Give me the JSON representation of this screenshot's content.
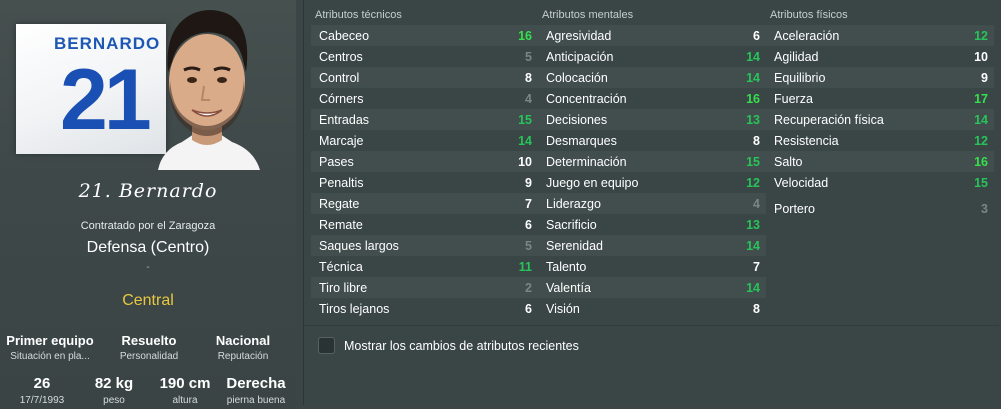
{
  "profile": {
    "kit_name": "BERNARDO",
    "kit_number": "21",
    "signature": "21. Bernardo",
    "contract": "Contratado por el Zaragoza",
    "position": "Defensa (Centro)",
    "dash": "-",
    "role": "Central",
    "info_top": [
      {
        "main": "Primer equipo",
        "sub": "Situación en pla..."
      },
      {
        "main": "Resuelto",
        "sub": "Personalidad"
      },
      {
        "main": "Nacional",
        "sub": "Reputación"
      }
    ],
    "info_bottom": [
      {
        "main": "26",
        "sub": "17/7/1993"
      },
      {
        "main": "82 kg",
        "sub": "peso"
      },
      {
        "main": "190 cm",
        "sub": "altura"
      },
      {
        "main": "Derecha",
        "sub": "pierna buena"
      }
    ]
  },
  "attributes": {
    "technical": {
      "title": "Atributos técnicos",
      "items": [
        {
          "label": "Cabeceo",
          "value": "16"
        },
        {
          "label": "Centros",
          "value": "5"
        },
        {
          "label": "Control",
          "value": "8"
        },
        {
          "label": "Córners",
          "value": "4"
        },
        {
          "label": "Entradas",
          "value": "15"
        },
        {
          "label": "Marcaje",
          "value": "14"
        },
        {
          "label": "Pases",
          "value": "10"
        },
        {
          "label": "Penaltis",
          "value": "9"
        },
        {
          "label": "Regate",
          "value": "7"
        },
        {
          "label": "Remate",
          "value": "6"
        },
        {
          "label": "Saques largos",
          "value": "5"
        },
        {
          "label": "Técnica",
          "value": "11"
        },
        {
          "label": "Tiro libre",
          "value": "2"
        },
        {
          "label": "Tiros lejanos",
          "value": "6"
        }
      ]
    },
    "mental": {
      "title": "Atributos mentales",
      "items": [
        {
          "label": "Agresividad",
          "value": "6"
        },
        {
          "label": "Anticipación",
          "value": "14"
        },
        {
          "label": "Colocación",
          "value": "14"
        },
        {
          "label": "Concentración",
          "value": "16"
        },
        {
          "label": "Decisiones",
          "value": "13"
        },
        {
          "label": "Desmarques",
          "value": "8"
        },
        {
          "label": "Determinación",
          "value": "15"
        },
        {
          "label": "Juego en equipo",
          "value": "12"
        },
        {
          "label": "Liderazgo",
          "value": "4"
        },
        {
          "label": "Sacrificio",
          "value": "13"
        },
        {
          "label": "Serenidad",
          "value": "14"
        },
        {
          "label": "Talento",
          "value": "7"
        },
        {
          "label": "Valentía",
          "value": "14"
        },
        {
          "label": "Visión",
          "value": "8"
        }
      ]
    },
    "physical": {
      "title": "Atributos físicos",
      "items": [
        {
          "label": "Aceleración",
          "value": "12"
        },
        {
          "label": "Agilidad",
          "value": "10"
        },
        {
          "label": "Equilibrio",
          "value": "9"
        },
        {
          "label": "Fuerza",
          "value": "17"
        },
        {
          "label": "Recuperación física",
          "value": "14"
        },
        {
          "label": "Resistencia",
          "value": "12"
        },
        {
          "label": "Salto",
          "value": "16"
        },
        {
          "label": "Velocidad",
          "value": "15"
        }
      ],
      "goalkeeper": {
        "label": "Portero",
        "value": "3"
      }
    }
  },
  "options": {
    "show_recent_changes_label": "Mostrar los cambios de atributos recientes",
    "show_recent_changes_checked": false
  },
  "colors": {
    "value_low": "#7c8585",
    "value_mid": "#ffffff",
    "value_good": "#27c45a",
    "value_high": "#34e04c",
    "role_color": "#e8c840",
    "kit_blue": "#1a4fb3"
  }
}
